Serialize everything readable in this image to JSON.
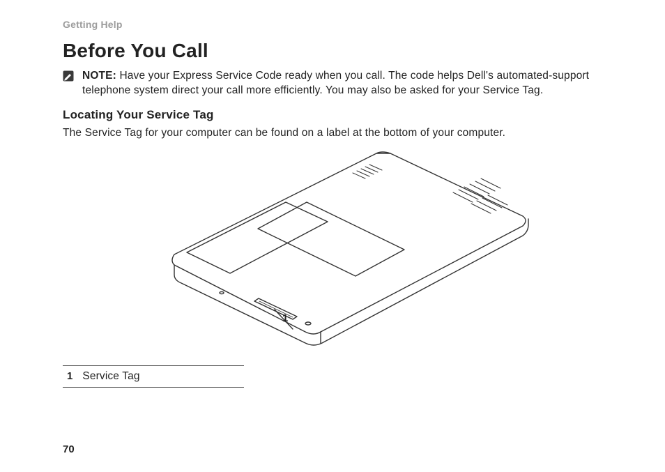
{
  "header": {
    "section": "Getting Help"
  },
  "title": "Before You Call",
  "note": {
    "label": "NOTE:",
    "text": "Have your Express Service Code ready when you call. The code helps Dell's automated-support telephone system direct your call more efficiently. You may also be asked for your Service Tag."
  },
  "subheading": "Locating Your Service Tag",
  "body": "The Service Tag for your computer can be found on a label at the bottom of your computer.",
  "figure": {
    "callout_number": "1",
    "alt": "Line drawing of the underside of a laptop computer with a callout pointing to the Service Tag label near the front edge."
  },
  "legend": {
    "items": [
      {
        "num": "1",
        "label": "Service Tag"
      }
    ]
  },
  "page_number": "70"
}
